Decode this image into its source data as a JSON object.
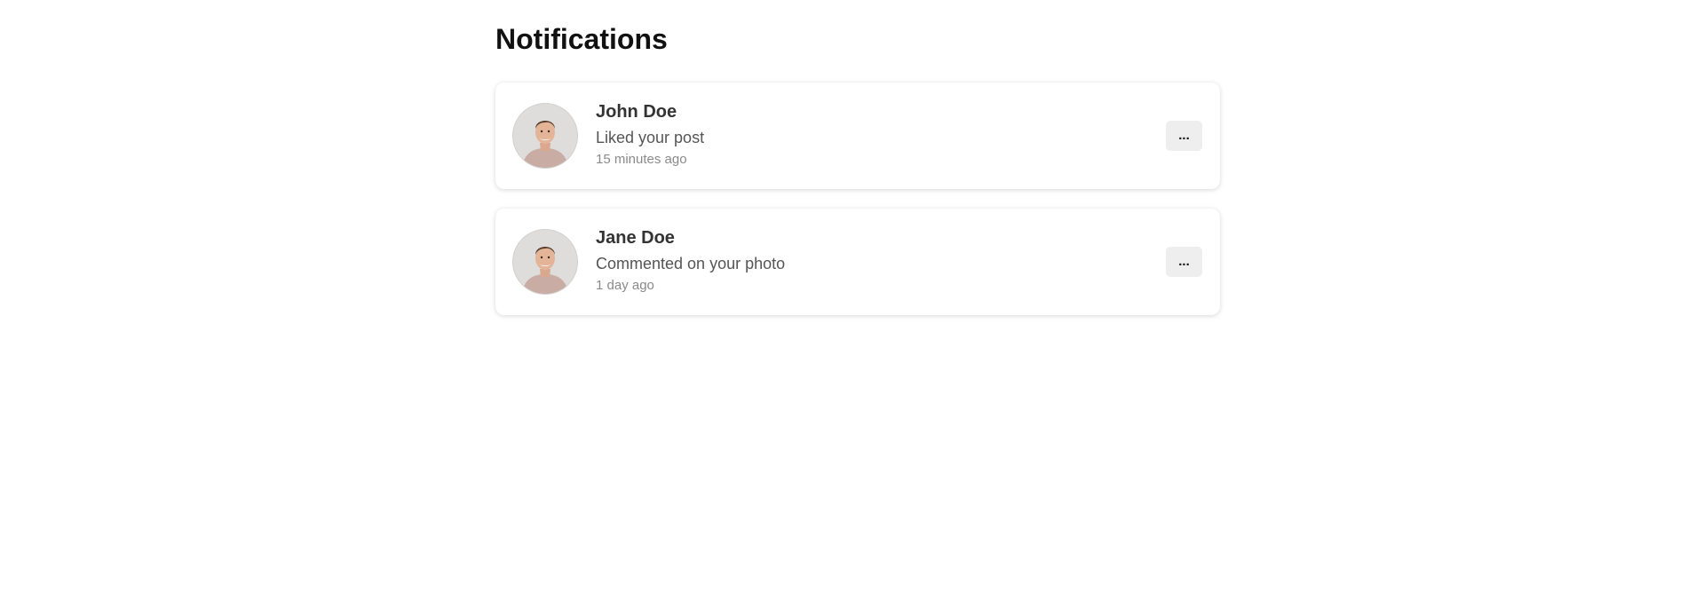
{
  "page": {
    "title": "Notifications"
  },
  "notifications": [
    {
      "name": "John Doe",
      "action": "Liked your post",
      "time": "15 minutes ago",
      "more_label": "..."
    },
    {
      "name": "Jane Doe",
      "action": "Commented on your photo",
      "time": "1 day ago",
      "more_label": "..."
    }
  ],
  "icons": {
    "avatar": "user-avatar-photo",
    "more": "ellipsis-icon"
  }
}
